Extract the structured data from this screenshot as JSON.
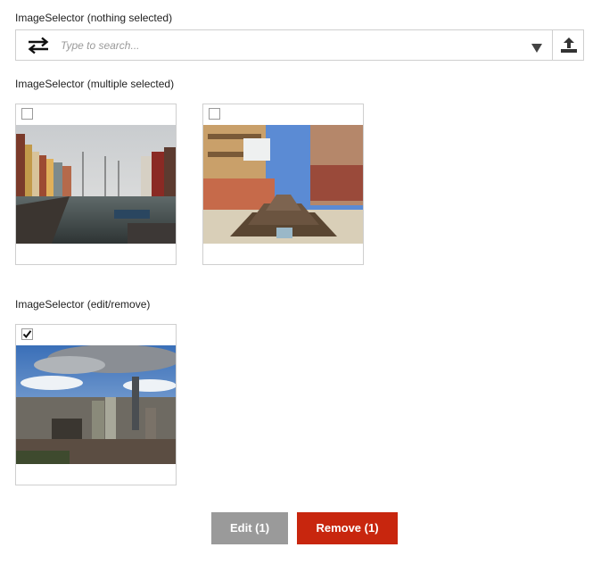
{
  "sections": [
    {
      "title": "ImageSelector (nothing selected)"
    },
    {
      "title": "ImageSelector (multiple selected)"
    },
    {
      "title": "ImageSelector (edit/remove)"
    }
  ],
  "selector": {
    "search_placeholder": "Type to search...",
    "swap_icon": "swap-arrows-icon",
    "dropdown_icon": "triangle-down-icon",
    "upload_icon": "upload-icon"
  },
  "images": [
    {
      "alt": "canal-harbor-photo",
      "checked": false
    },
    {
      "alt": "stair-fountain-plaza-photo",
      "checked": false
    },
    {
      "alt": "city-skyline-photo",
      "checked": true
    }
  ],
  "actions": {
    "edit_label": "Edit (1)",
    "remove_label": "Remove (1)"
  },
  "colors": {
    "edit_bg": "#9a9a9a",
    "remove_bg": "#c8260e",
    "border": "#cfcfcf"
  }
}
